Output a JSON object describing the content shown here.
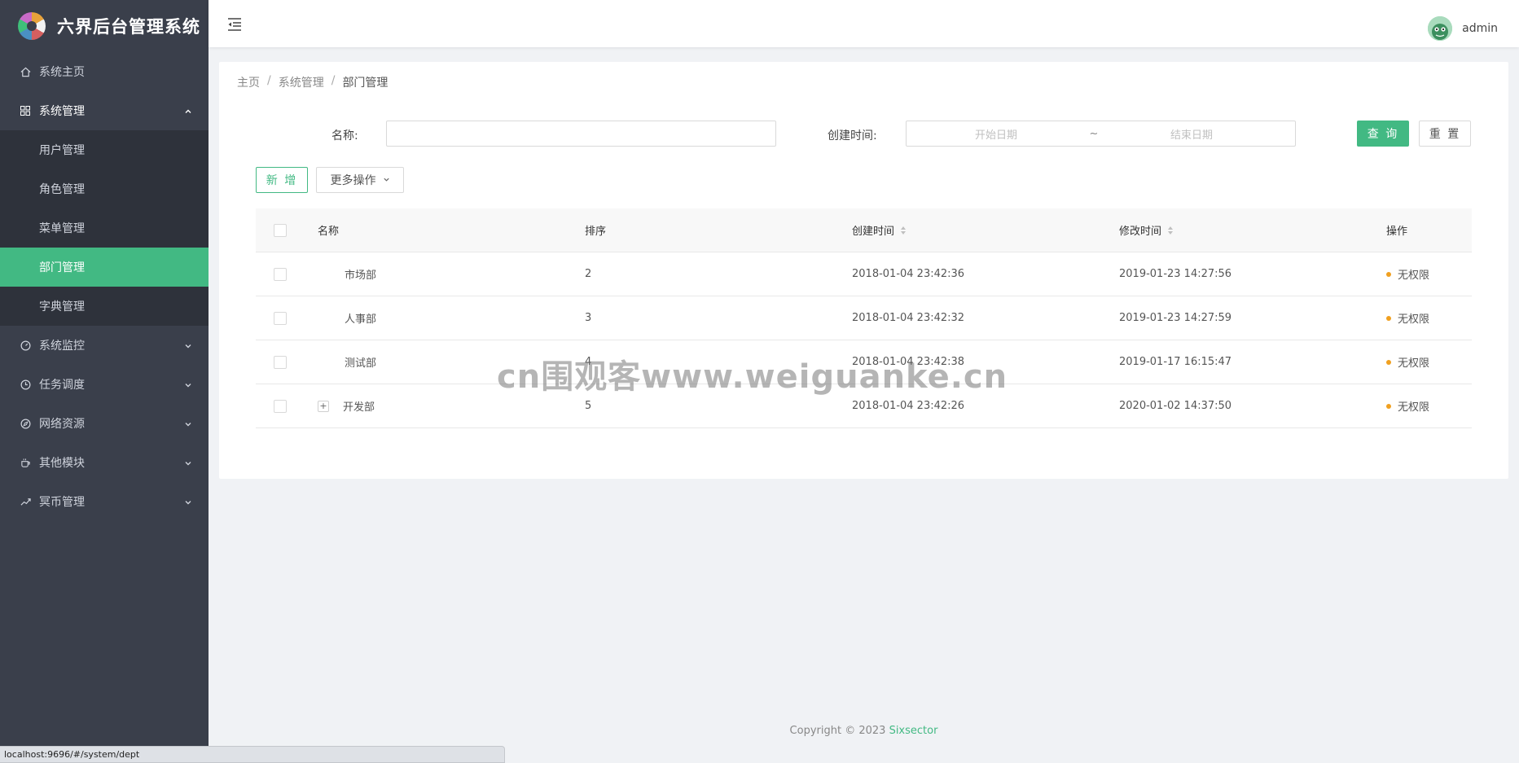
{
  "app": {
    "title": "六界后台管理系统"
  },
  "sidebar": {
    "items": [
      {
        "label": "系统主页",
        "icon": "home-icon"
      },
      {
        "label": "系统管理",
        "icon": "grid-icon",
        "open": true,
        "children": [
          "用户管理",
          "角色管理",
          "菜单管理",
          "部门管理",
          "字典管理"
        ],
        "active_child": "部门管理"
      },
      {
        "label": "系统监控",
        "icon": "dashboard-icon"
      },
      {
        "label": "任务调度",
        "icon": "clock-icon"
      },
      {
        "label": "网络资源",
        "icon": "compass-icon"
      },
      {
        "label": "其他模块",
        "icon": "coffee-icon"
      },
      {
        "label": "冥币管理",
        "icon": "line-chart-icon"
      }
    ]
  },
  "header": {
    "username": "admin"
  },
  "breadcrumb": [
    "主页",
    "系统管理",
    "部门管理"
  ],
  "breadcrumb_sep": "/",
  "search": {
    "name_label": "名称:",
    "name_value": "",
    "created_label": "创建时间:",
    "start_placeholder": "开始日期",
    "range_sep": "~",
    "end_placeholder": "结束日期",
    "query_button": "查 询",
    "reset_button": "重 置"
  },
  "toolbar": {
    "add_button": "新 增",
    "more_button": "更多操作"
  },
  "table": {
    "columns": [
      "名称",
      "排序",
      "创建时间",
      "修改时间",
      "操作"
    ],
    "rows": [
      {
        "name": "市场部",
        "order": "2",
        "created": "2018-01-04 23:42:36",
        "modified": "2019-01-23 14:27:56",
        "op": "无权限",
        "expandable": false
      },
      {
        "name": "人事部",
        "order": "3",
        "created": "2018-01-04 23:42:32",
        "modified": "2019-01-23 14:27:59",
        "op": "无权限",
        "expandable": false
      },
      {
        "name": "测试部",
        "order": "4",
        "created": "2018-01-04 23:42:38",
        "modified": "2019-01-17 16:15:47",
        "op": "无权限",
        "expandable": false
      },
      {
        "name": "开发部",
        "order": "5",
        "created": "2018-01-04 23:42:26",
        "modified": "2020-01-02 14:37:50",
        "op": "无权限",
        "expandable": true
      }
    ]
  },
  "watermark": "cn围观客www.weiguanke.cn",
  "footer": {
    "copyright": "Copyright © 2023",
    "brand": "Sixsector"
  },
  "status_url": "localhost:9696/#/system/dept",
  "colors": {
    "primary": "#42b983",
    "sidebar_bg": "#3a3f4b",
    "submenu_bg": "#2e323b",
    "op_dot": "#f0a020"
  }
}
